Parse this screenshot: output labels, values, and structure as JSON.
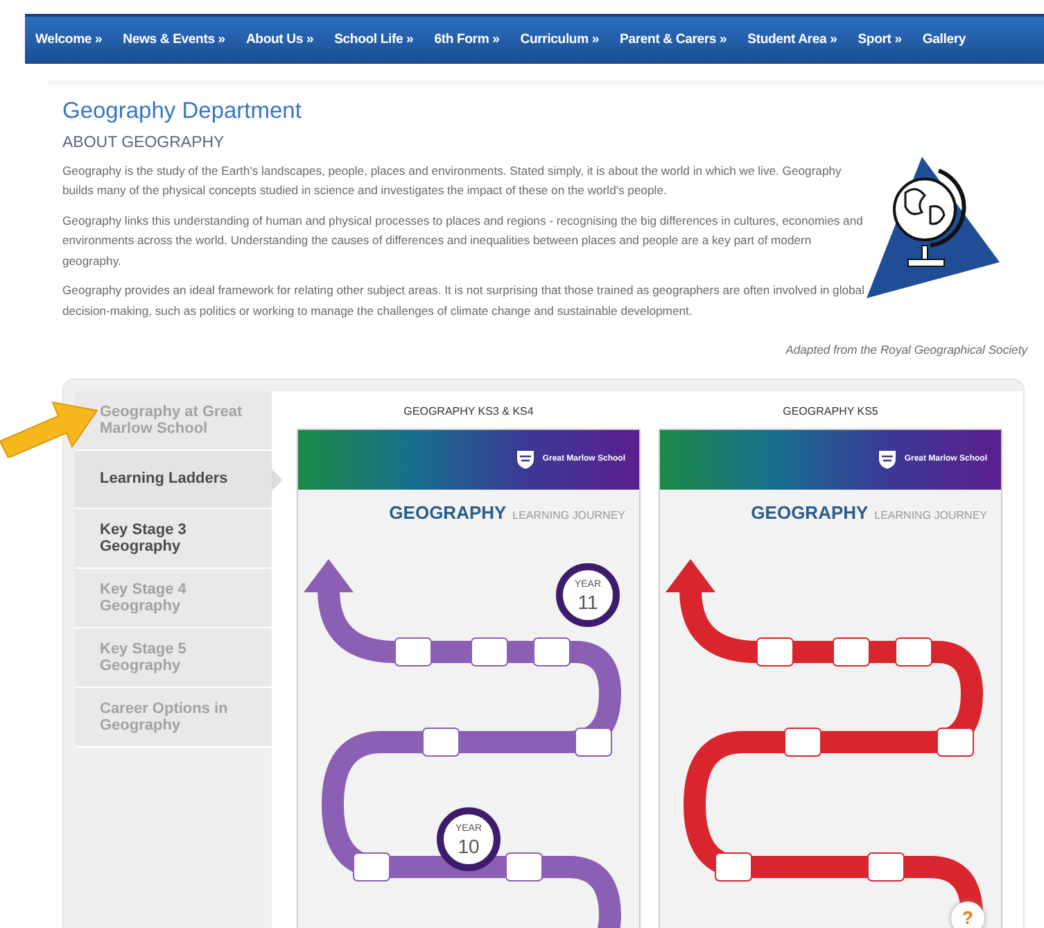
{
  "nav": [
    "Welcome »",
    "News & Events »",
    "About Us »",
    "School Life »",
    "6th Form »",
    "Curriculum »",
    "Parent & Carers »",
    "Student Area »",
    "Sport »",
    "Gallery"
  ],
  "page": {
    "title": "Geography Department",
    "heading": "ABOUT GEOGRAPHY",
    "paragraphs": [
      "Geography is the study of the Earth's landscapes, people, places and environments. Stated simply, it is about the world in which we live. Geography builds many of the physical concepts studied in science and investigates the impact of these on the world's people.",
      "Geography links this understanding of human and physical processes to places and regions - recognising the big differences in cultures, economies and environments across the world. Understanding the causes of differences and inequalities between places and people are a key part of modern geography.",
      "Geography provides an ideal framework for relating other subject areas. It is not surprising that those trained as geographers are often involved in global decision-making, such as politics or working to manage the challenges of climate change and sustainable development."
    ],
    "attribution": "Adapted from the Royal Geographical Society"
  },
  "sidebar": {
    "items": [
      {
        "label": "Geography at Great Marlow School",
        "selected": false,
        "dimmed": true
      },
      {
        "label": "Learning Ladders",
        "selected": true,
        "dimmed": false
      },
      {
        "label": "Key Stage 3 Geography",
        "selected": false,
        "dimmed": false
      },
      {
        "label": "Key Stage 4 Geography",
        "selected": false,
        "dimmed": true
      },
      {
        "label": "Key Stage 5 Geography",
        "selected": false,
        "dimmed": true
      },
      {
        "label": "Career Options in Geography",
        "selected": false,
        "dimmed": true
      }
    ]
  },
  "posters": [
    {
      "caption": "GEOGRAPHY KS3 & KS4",
      "school": "Great Marlow School",
      "title": "GEOGRAPHY",
      "subtitle": "LEARNING JOURNEY",
      "color": "#8b5fb3",
      "years": [
        {
          "word": "YEAR",
          "number": "11"
        },
        {
          "word": "YEAR",
          "number": "10"
        }
      ]
    },
    {
      "caption": "GEOGRAPHY KS5",
      "school": "Great Marlow School",
      "title": "GEOGRAPHY",
      "subtitle": "LEARNING JOURNEY",
      "color": "#d9262e",
      "help": "?"
    }
  ]
}
